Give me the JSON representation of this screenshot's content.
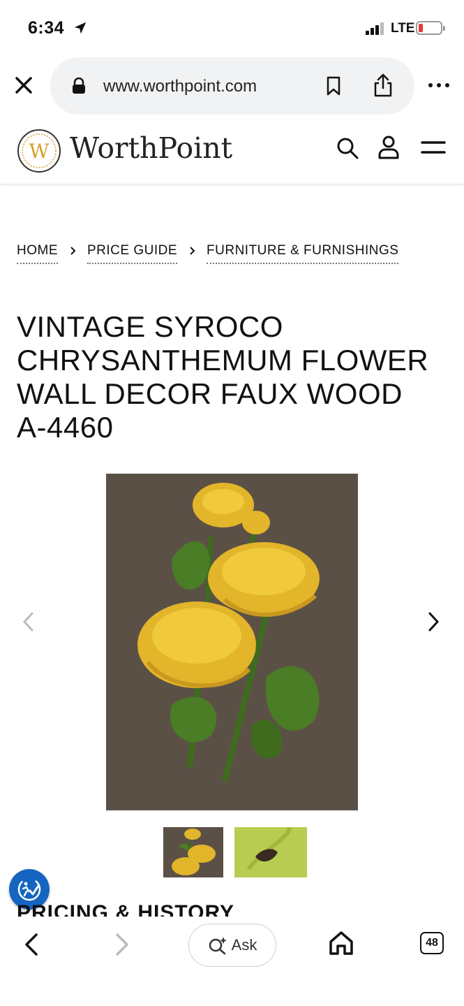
{
  "status_bar": {
    "time": "6:34",
    "network": "LTE",
    "battery_color": "#e53935"
  },
  "browser": {
    "url": "www.worthpoint.com"
  },
  "site": {
    "logo_text": "WorthPoint",
    "logo_letter": "W",
    "brand_color": "#d4a02a"
  },
  "breadcrumb": [
    "HOME",
    "PRICE GUIDE",
    "FURNITURE & FURNISHINGS"
  ],
  "product": {
    "title": "VINTAGE SYROCO CHRYSANTHEMUM FLOWER WALL DECOR FAUX WOOD A-4460",
    "image_count": 2
  },
  "section": {
    "heading": "PRICING & HISTORY"
  },
  "toolbar": {
    "ask_label": "Ask",
    "tab_count": "48"
  },
  "icons": [
    "location-arrow-icon",
    "signal-icon",
    "battery-icon",
    "close-icon",
    "lock-icon",
    "bookmark-icon",
    "share-icon",
    "more-icon",
    "search-icon",
    "user-icon",
    "menu-icon",
    "chevron-right-icon",
    "chevron-left-icon",
    "accessibility-icon",
    "back-icon",
    "forward-icon",
    "ask-sparkle-icon",
    "home-icon",
    "tabs-icon"
  ]
}
